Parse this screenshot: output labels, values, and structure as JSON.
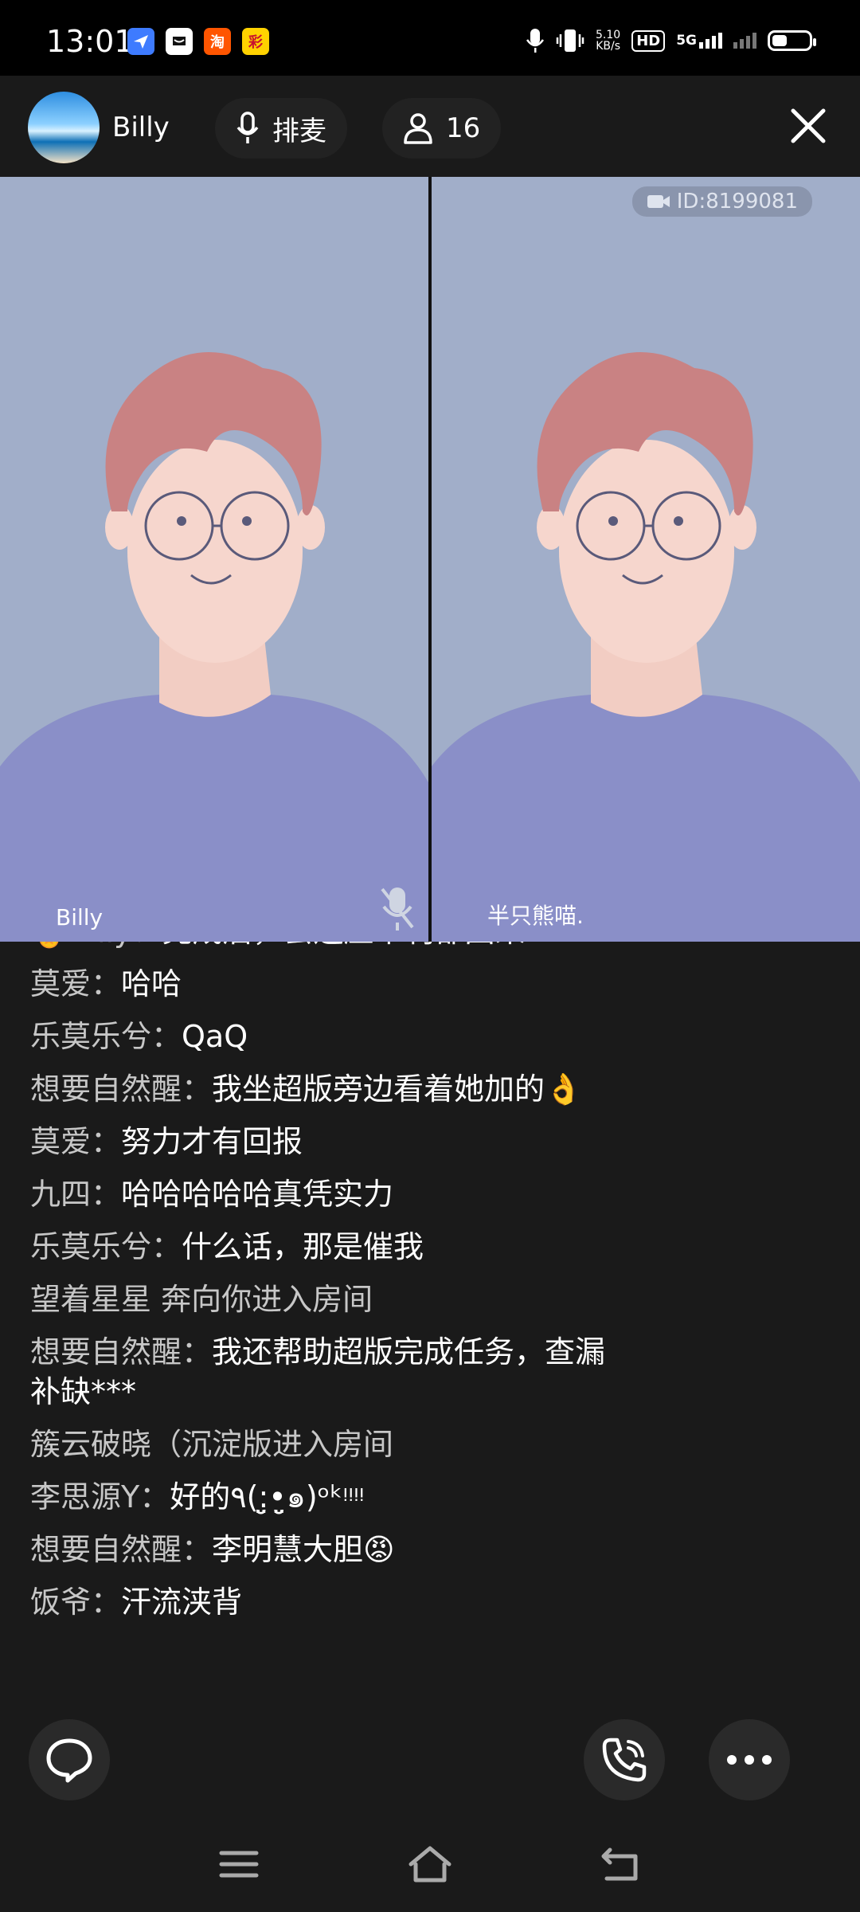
{
  "status_bar": {
    "time": "13:01",
    "net_speed": "5.10",
    "net_unit": "KB/s",
    "hd": "HD",
    "signal": "5G",
    "apps": [
      {
        "icon": "feishu-icon",
        "color": "#3e7bff",
        "label": ""
      },
      {
        "icon": "message-icon",
        "color": "#ff4d4f",
        "label": ""
      },
      {
        "icon": "taobao-icon",
        "color": "#ff5500",
        "label": "淘"
      },
      {
        "icon": "lottery-icon",
        "color": "#e02e24",
        "label": "彩"
      }
    ]
  },
  "header": {
    "host_name": "Billy",
    "mic_queue_label": "排麦",
    "audience_count": "16"
  },
  "video": {
    "room_id": "ID:8199081",
    "tiles": [
      {
        "name": "Billy",
        "muted": true
      },
      {
        "name": "半只熊喵."
      }
    ]
  },
  "chat": {
    "messages": [
      {
        "nick": "🏅Billy：",
        "text": "完成后，会连压带利都回来"
      },
      {
        "nick": "莫爱：",
        "text": "哈哈"
      },
      {
        "nick": "乐莫乐兮：",
        "text": "QaQ"
      },
      {
        "nick": "想要自然醒：",
        "text": "我坐超版旁边看着她加的👌"
      },
      {
        "nick": "莫爱：",
        "text": "努力才有回报"
      },
      {
        "nick": "九四：",
        "text": "哈哈哈哈哈真凭实力"
      },
      {
        "nick": "乐莫乐兮：",
        "text": "什么话，那是催我"
      },
      {
        "system": "望着星星 奔向你进入房间"
      },
      {
        "nick": "想要自然醒：",
        "text": "我还帮助超版完成任务，查漏补缺***"
      },
      {
        "system": "簇云破晓（沉淀版进入房间"
      },
      {
        "nick": "李思源Y：",
        "text": "好的٩(:̤̮•̤̮๑)ᵒᵏᵎᵎᵎᵎ"
      },
      {
        "nick": "想要自然醒：",
        "text": "李明慧大胆😡"
      },
      {
        "nick": "饭爷：",
        "text": "汗流浃背"
      }
    ]
  }
}
